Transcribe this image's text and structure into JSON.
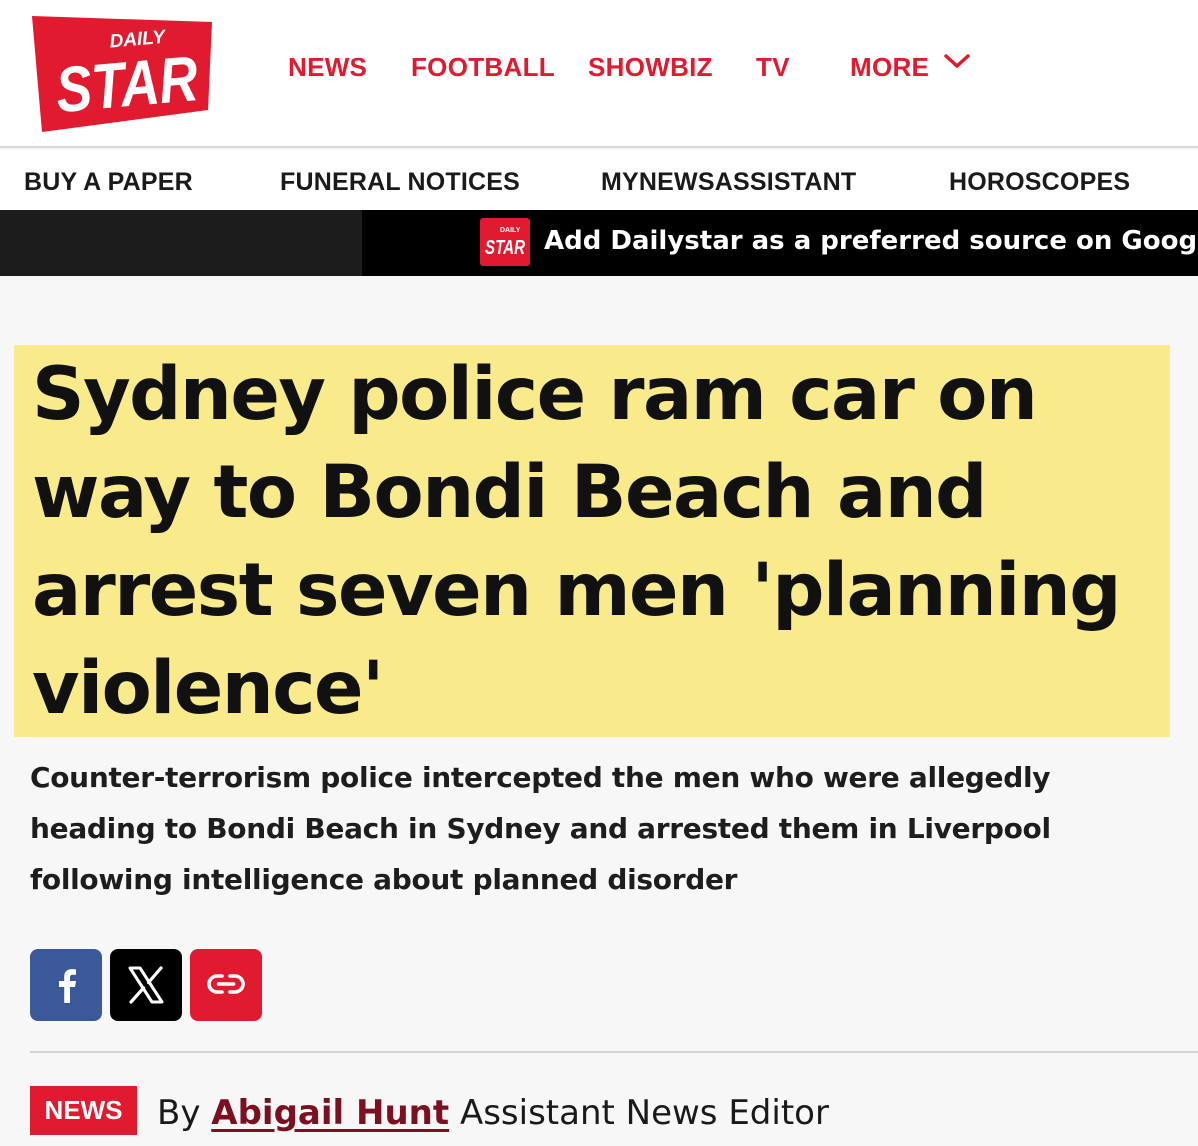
{
  "brand": {
    "logo_small": "DAILY",
    "logo_large": "STAR",
    "color": "#e01a2f"
  },
  "nav": {
    "items": [
      "NEWS",
      "FOOTBALL",
      "SHOWBIZ",
      "TV",
      "MORE"
    ],
    "more_icon": "chevron-down-icon"
  },
  "subnav": {
    "items": [
      "BUY A PAPER",
      "FUNERAL NOTICES",
      "MYNEWSASSISTANT",
      "HOROSCOPES"
    ]
  },
  "banner": {
    "logo_small": "DAILY",
    "logo_large": "STAR",
    "text": "Add Dailystar as a preferred source on Google"
  },
  "article": {
    "headline": "Sydney police ram car on way to Bondi Beach and arrest seven men 'planning violence'",
    "highlight_color": "#f9ea8b",
    "standfirst": "Counter-terrorism police intercepted the men who were allegedly heading to Bondi Beach in Sydney and arrested them in Liverpool following intelligence about planned disorder"
  },
  "share": {
    "buttons": [
      {
        "icon": "facebook-icon",
        "color": "#3b5998"
      },
      {
        "icon": "x-icon",
        "color": "#000000"
      },
      {
        "icon": "link-icon",
        "color": "#e01a2f"
      }
    ]
  },
  "byline": {
    "section": "NEWS",
    "prefix": "By",
    "author": "Abigail Hunt",
    "role": "Assistant News Editor"
  }
}
